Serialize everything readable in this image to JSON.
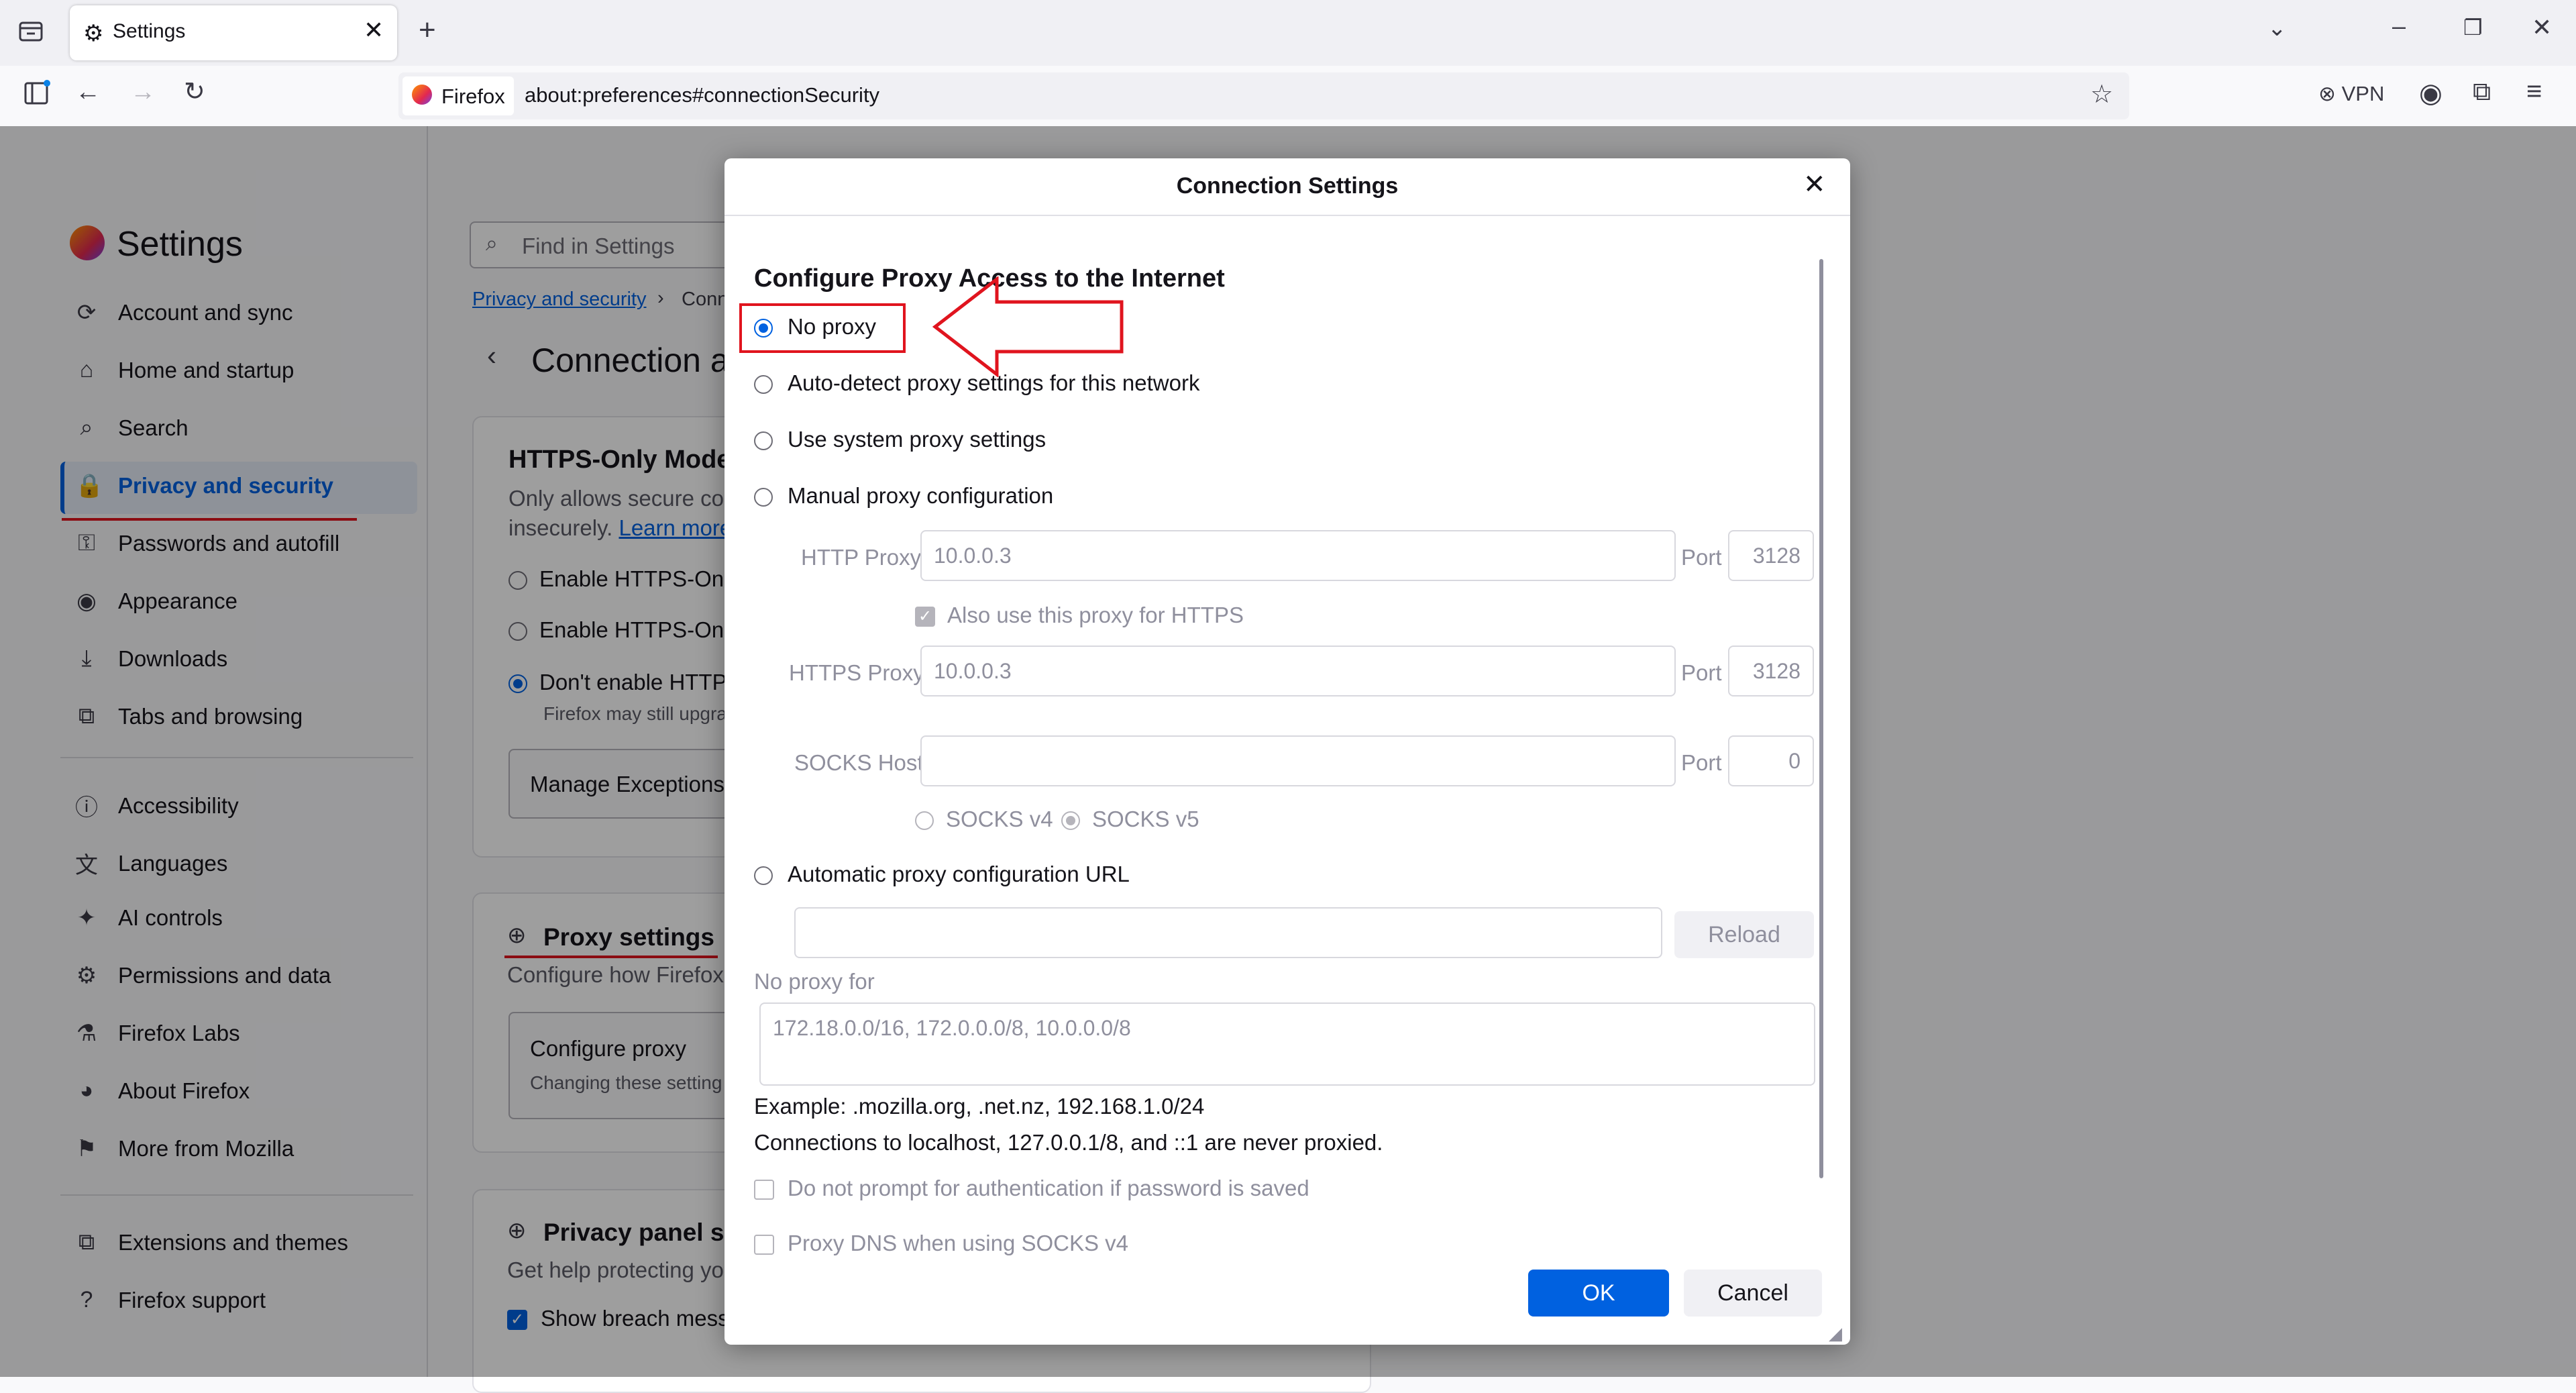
{
  "browser": {
    "tab_title": "Settings",
    "identity_label": "Firefox",
    "url": "about:preferences#connectionSecurity",
    "vpn_label": "VPN"
  },
  "settings": {
    "title": "Settings",
    "search_placeholder": "Find in Settings",
    "breadcrumb_root": "Privacy and security",
    "breadcrumb_current": "Conn",
    "page_title": "Connection a",
    "nav_items": [
      "Account and sync",
      "Home and startup",
      "Search",
      "Privacy and security",
      "Passwords and autofill",
      "Appearance",
      "Downloads",
      "Tabs and browsing",
      "Accessibility",
      "Languages",
      "AI controls",
      "Permissions and data",
      "Firefox Labs",
      "About Firefox",
      "More from Mozilla",
      "Extensions and themes",
      "Firefox support"
    ],
    "https_only": {
      "title": "HTTPS-Only Mode",
      "desc1": "Only allows secure co",
      "desc2": "insecurely.",
      "learn_more": "Learn more",
      "options": [
        "Enable HTTPS-Only",
        "Enable HTTPS-Only",
        "Don't enable HTTP"
      ],
      "note": "Firefox may still upgra",
      "manage": "Manage Exceptions"
    },
    "proxy": {
      "title": "Proxy settings",
      "desc": "Configure how Firefox",
      "button": "Configure proxy",
      "button_sub": "Changing these setting"
    },
    "privacy_panel": {
      "title": "Privacy panel se",
      "desc": "Get help protecting yo",
      "checkbox": "Show breach mess"
    }
  },
  "dialog": {
    "title": "Connection Settings",
    "heading": "Configure Proxy Access to the Internet",
    "options": [
      "No proxy",
      "Auto-detect proxy settings for this network",
      "Use system proxy settings",
      "Manual proxy configuration",
      "Automatic proxy configuration URL"
    ],
    "selected_option": "No proxy",
    "http_proxy_label": "HTTP Proxy",
    "http_proxy_value": "10.0.0.3",
    "port_label": "Port",
    "http_port": "3128",
    "also_https": "Also use this proxy for HTTPS",
    "https_proxy_label": "HTTPS Proxy",
    "https_proxy_value": "10.0.0.3",
    "https_port": "3128",
    "socks_host_label": "SOCKS Host",
    "socks_host_value": "",
    "socks_port": "0",
    "socks_v4": "SOCKS v4",
    "socks_v5": "SOCKS v5",
    "auto_url_value": "",
    "reload": "Reload",
    "no_proxy_for_label": "No proxy for",
    "no_proxy_for_value": "172.18.0.0/16, 172.0.0.0/8, 10.0.0.0/8",
    "example": "Example: .mozilla.org, .net.nz, 192.168.1.0/24",
    "localhost_note": "Connections to localhost, 127.0.0.1/8, and ::1 are never proxied.",
    "no_prompt_auth": "Do not prompt for authentication if password is saved",
    "proxy_dns": "Proxy DNS when using SOCKS v4",
    "ok": "OK",
    "cancel": "Cancel"
  },
  "colors": {
    "accent": "#0061e0",
    "annotation": "#e0141e"
  }
}
